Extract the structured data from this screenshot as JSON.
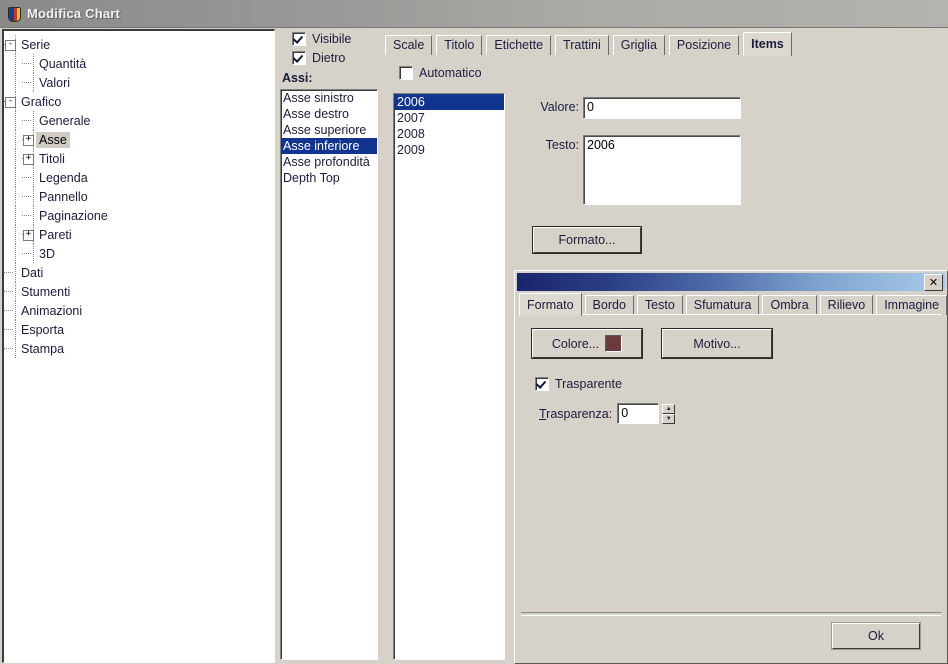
{
  "window": {
    "title": "Modifica Chart",
    "icon": "chart-app-icon"
  },
  "tree": {
    "items": [
      {
        "label": "Serie",
        "depth": 0,
        "toggle": "-",
        "selected": false
      },
      {
        "label": "Quantità",
        "depth": 1,
        "toggle": "",
        "selected": false
      },
      {
        "label": "Valori",
        "depth": 1,
        "toggle": "",
        "selected": false
      },
      {
        "label": "Grafico",
        "depth": 0,
        "toggle": "-",
        "selected": false
      },
      {
        "label": "Generale",
        "depth": 1,
        "toggle": "",
        "selected": false
      },
      {
        "label": "Asse",
        "depth": 1,
        "toggle": "+",
        "selected": true
      },
      {
        "label": "Titoli",
        "depth": 1,
        "toggle": "+",
        "selected": false
      },
      {
        "label": "Legenda",
        "depth": 1,
        "toggle": "",
        "selected": false
      },
      {
        "label": "Pannello",
        "depth": 1,
        "toggle": "",
        "selected": false
      },
      {
        "label": "Paginazione",
        "depth": 1,
        "toggle": "",
        "selected": false
      },
      {
        "label": "Pareti",
        "depth": 1,
        "toggle": "+",
        "selected": false
      },
      {
        "label": "3D",
        "depth": 1,
        "toggle": "",
        "selected": false
      },
      {
        "label": "Dati",
        "depth": 0,
        "toggle": "",
        "selected": false
      },
      {
        "label": "Stumenti",
        "depth": 0,
        "toggle": "",
        "selected": false
      },
      {
        "label": "Animazioni",
        "depth": 0,
        "toggle": "",
        "selected": false
      },
      {
        "label": "Esporta",
        "depth": 0,
        "toggle": "",
        "selected": false
      },
      {
        "label": "Stampa",
        "depth": 0,
        "toggle": "",
        "selected": false
      }
    ]
  },
  "axis_panel": {
    "visible_checkbox": {
      "label": "Visibile",
      "checked": true
    },
    "behind_checkbox": {
      "label": "Dietro",
      "checked": true
    },
    "list_label": "Assi:",
    "axes": [
      {
        "label": "Asse sinistro",
        "selected": false
      },
      {
        "label": "Asse destro",
        "selected": false
      },
      {
        "label": "Asse superiore",
        "selected": false
      },
      {
        "label": "Asse inferiore",
        "selected": true
      },
      {
        "label": "Asse profondità",
        "selected": false
      },
      {
        "label": "Depth Top",
        "selected": false
      }
    ]
  },
  "main_tabs": {
    "items": [
      {
        "label": "Scale",
        "active": false
      },
      {
        "label": "Titolo",
        "active": false
      },
      {
        "label": "Etichette",
        "active": false
      },
      {
        "label": "Trattini",
        "active": false
      },
      {
        "label": "Griglia",
        "active": false
      },
      {
        "label": "Posizione",
        "active": false
      },
      {
        "label": "Items",
        "active": true
      }
    ]
  },
  "items_panel": {
    "automatic_checkbox": {
      "label": "Automatico",
      "checked": false
    },
    "years": [
      {
        "label": "2006",
        "selected": true
      },
      {
        "label": "2007",
        "selected": false
      },
      {
        "label": "2008",
        "selected": false
      },
      {
        "label": "2009",
        "selected": false
      }
    ],
    "value_label": "Valore:",
    "value_text": "0",
    "text_label": "Testo:",
    "text_value": "2006",
    "format_button": "Formato..."
  },
  "format_dialog": {
    "close_label": "✕",
    "tabs": [
      {
        "label": "Formato",
        "active": true
      },
      {
        "label": "Bordo",
        "active": false
      },
      {
        "label": "Testo",
        "active": false
      },
      {
        "label": "Sfumatura",
        "active": false
      },
      {
        "label": "Ombra",
        "active": false
      },
      {
        "label": "Rilievo",
        "active": false
      },
      {
        "label": "Immagine",
        "active": false
      }
    ],
    "color_button": "Colore...",
    "color_swatch": "#6b3b3b",
    "pattern_button": "Motivo...",
    "transparent_checkbox": {
      "label": "Trasparente",
      "checked": true
    },
    "transparency_label": "Trasparenza:",
    "transparency_value": "0",
    "ok_button": "Ok"
  },
  "colors": {
    "face": "#d6d2ca",
    "selection": "#11358f",
    "caption_start": "#19246e",
    "caption_end": "#a9cbe9",
    "text": "#1c1c3c"
  }
}
